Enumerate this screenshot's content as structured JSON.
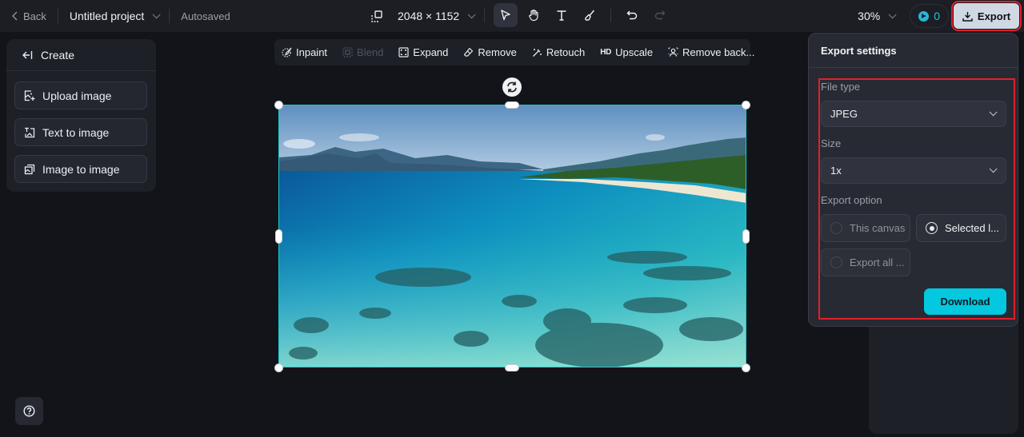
{
  "topbar": {
    "back_label": "Back",
    "project_title": "Untitled project",
    "save_status": "Autosaved",
    "canvas_size": "2048 × 1152",
    "zoom_level": "30%",
    "credits": "0",
    "export_label": "Export",
    "tools": [
      {
        "name": "select",
        "icon": "cursor-arrow-icon",
        "active": true
      },
      {
        "name": "hand",
        "icon": "hand-icon",
        "active": false
      },
      {
        "name": "text",
        "icon": "text-icon",
        "active": false
      },
      {
        "name": "brush",
        "icon": "brush-icon",
        "active": false
      },
      {
        "name": "undo",
        "icon": "undo-icon",
        "active": false
      },
      {
        "name": "redo",
        "icon": "redo-icon",
        "active": false,
        "disabled": true
      }
    ]
  },
  "create_panel": {
    "title": "Create",
    "items": [
      {
        "label": "Upload image",
        "icon": "upload-image-icon"
      },
      {
        "label": "Text to image",
        "icon": "text-to-image-icon"
      },
      {
        "label": "Image to image",
        "icon": "image-to-image-icon"
      }
    ]
  },
  "image_toolbar": {
    "items": [
      {
        "label": "Inpaint",
        "icon": "inpaint-icon",
        "disabled": false
      },
      {
        "label": "Blend",
        "icon": "blend-icon",
        "disabled": true
      },
      {
        "label": "Expand",
        "icon": "expand-icon",
        "disabled": false
      },
      {
        "label": "Remove",
        "icon": "eraser-icon",
        "disabled": false
      },
      {
        "label": "Retouch",
        "icon": "magic-wand-icon",
        "disabled": false
      },
      {
        "label": "Upscale",
        "icon": "hd-icon",
        "icon_text": "HD",
        "disabled": false
      },
      {
        "label": "Remove back...",
        "icon": "remove-background-icon",
        "disabled": false
      }
    ]
  },
  "canvas": {
    "image_description": "Tropical beach with turquoise water, coral reef, palm-lined shore and mountains",
    "selection_color": "#1fc7cf"
  },
  "export_settings": {
    "title": "Export settings",
    "file_type_label": "File type",
    "file_type_value": "JPEG",
    "size_label": "Size",
    "size_value": "1x",
    "export_option_label": "Export option",
    "options": [
      {
        "label": "This canvas",
        "selected": false
      },
      {
        "label": "Selected l...",
        "selected": true
      },
      {
        "label": "Export all ...",
        "selected": false
      }
    ],
    "download_label": "Download",
    "accent_color": "#03c8e0",
    "highlight_color": "#e0202c"
  },
  "help": {
    "icon": "help-icon"
  }
}
